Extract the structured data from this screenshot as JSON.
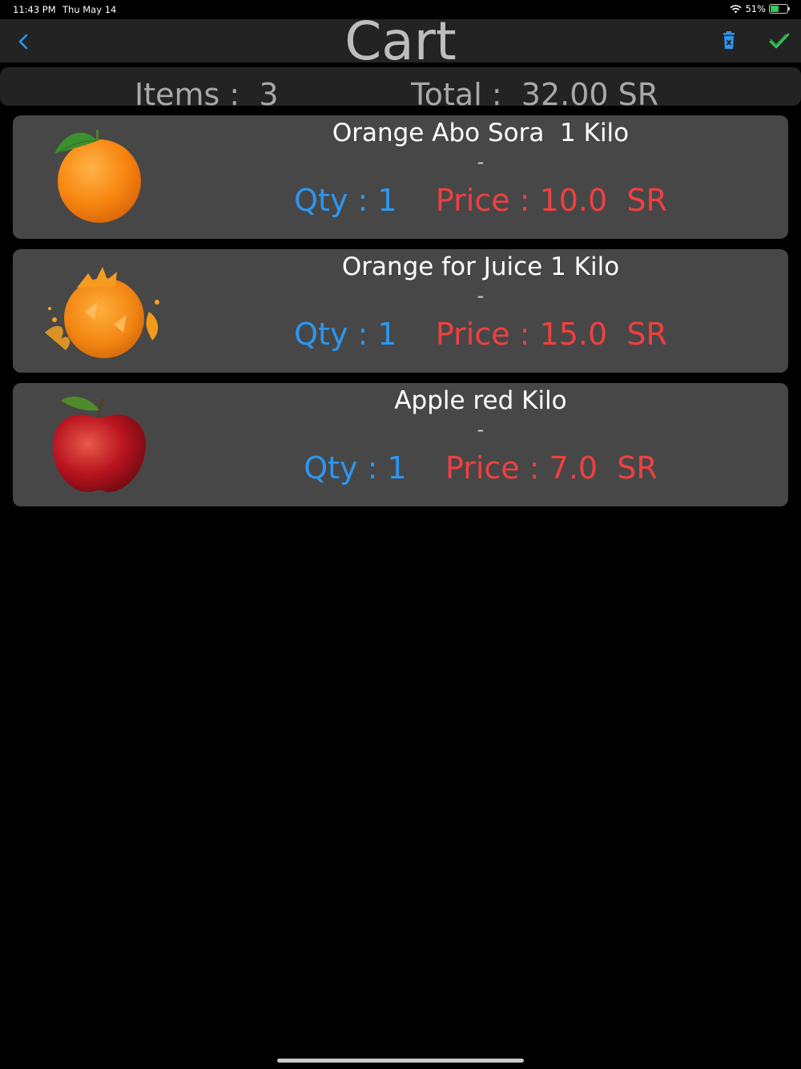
{
  "status_bar": {
    "time": "11:43 PM",
    "date": "Thu May 14",
    "battery": "51%"
  },
  "nav": {
    "title": "Cart"
  },
  "summary": {
    "items": "Items :  3",
    "total": "Total :  32.00 SR"
  },
  "cart_items": [
    {
      "name": "Orange Abo Sora  1 Kilo",
      "subtitle": "-",
      "qty": "Qty : 1",
      "price": "Price : 10.0  SR"
    },
    {
      "name": "Orange for Juice 1 Kilo",
      "subtitle": "-",
      "qty": "Qty : 1",
      "price": "Price : 15.0  SR"
    },
    {
      "name": "Apple red Kilo",
      "subtitle": "-",
      "qty": "Qty : 1",
      "price": "Price : 7.0  SR"
    }
  ],
  "colors": {
    "accent": "#2d96f0",
    "price": "#ee4040",
    "confirm": "#34c759",
    "card": "#474747",
    "bar": "#232323"
  }
}
